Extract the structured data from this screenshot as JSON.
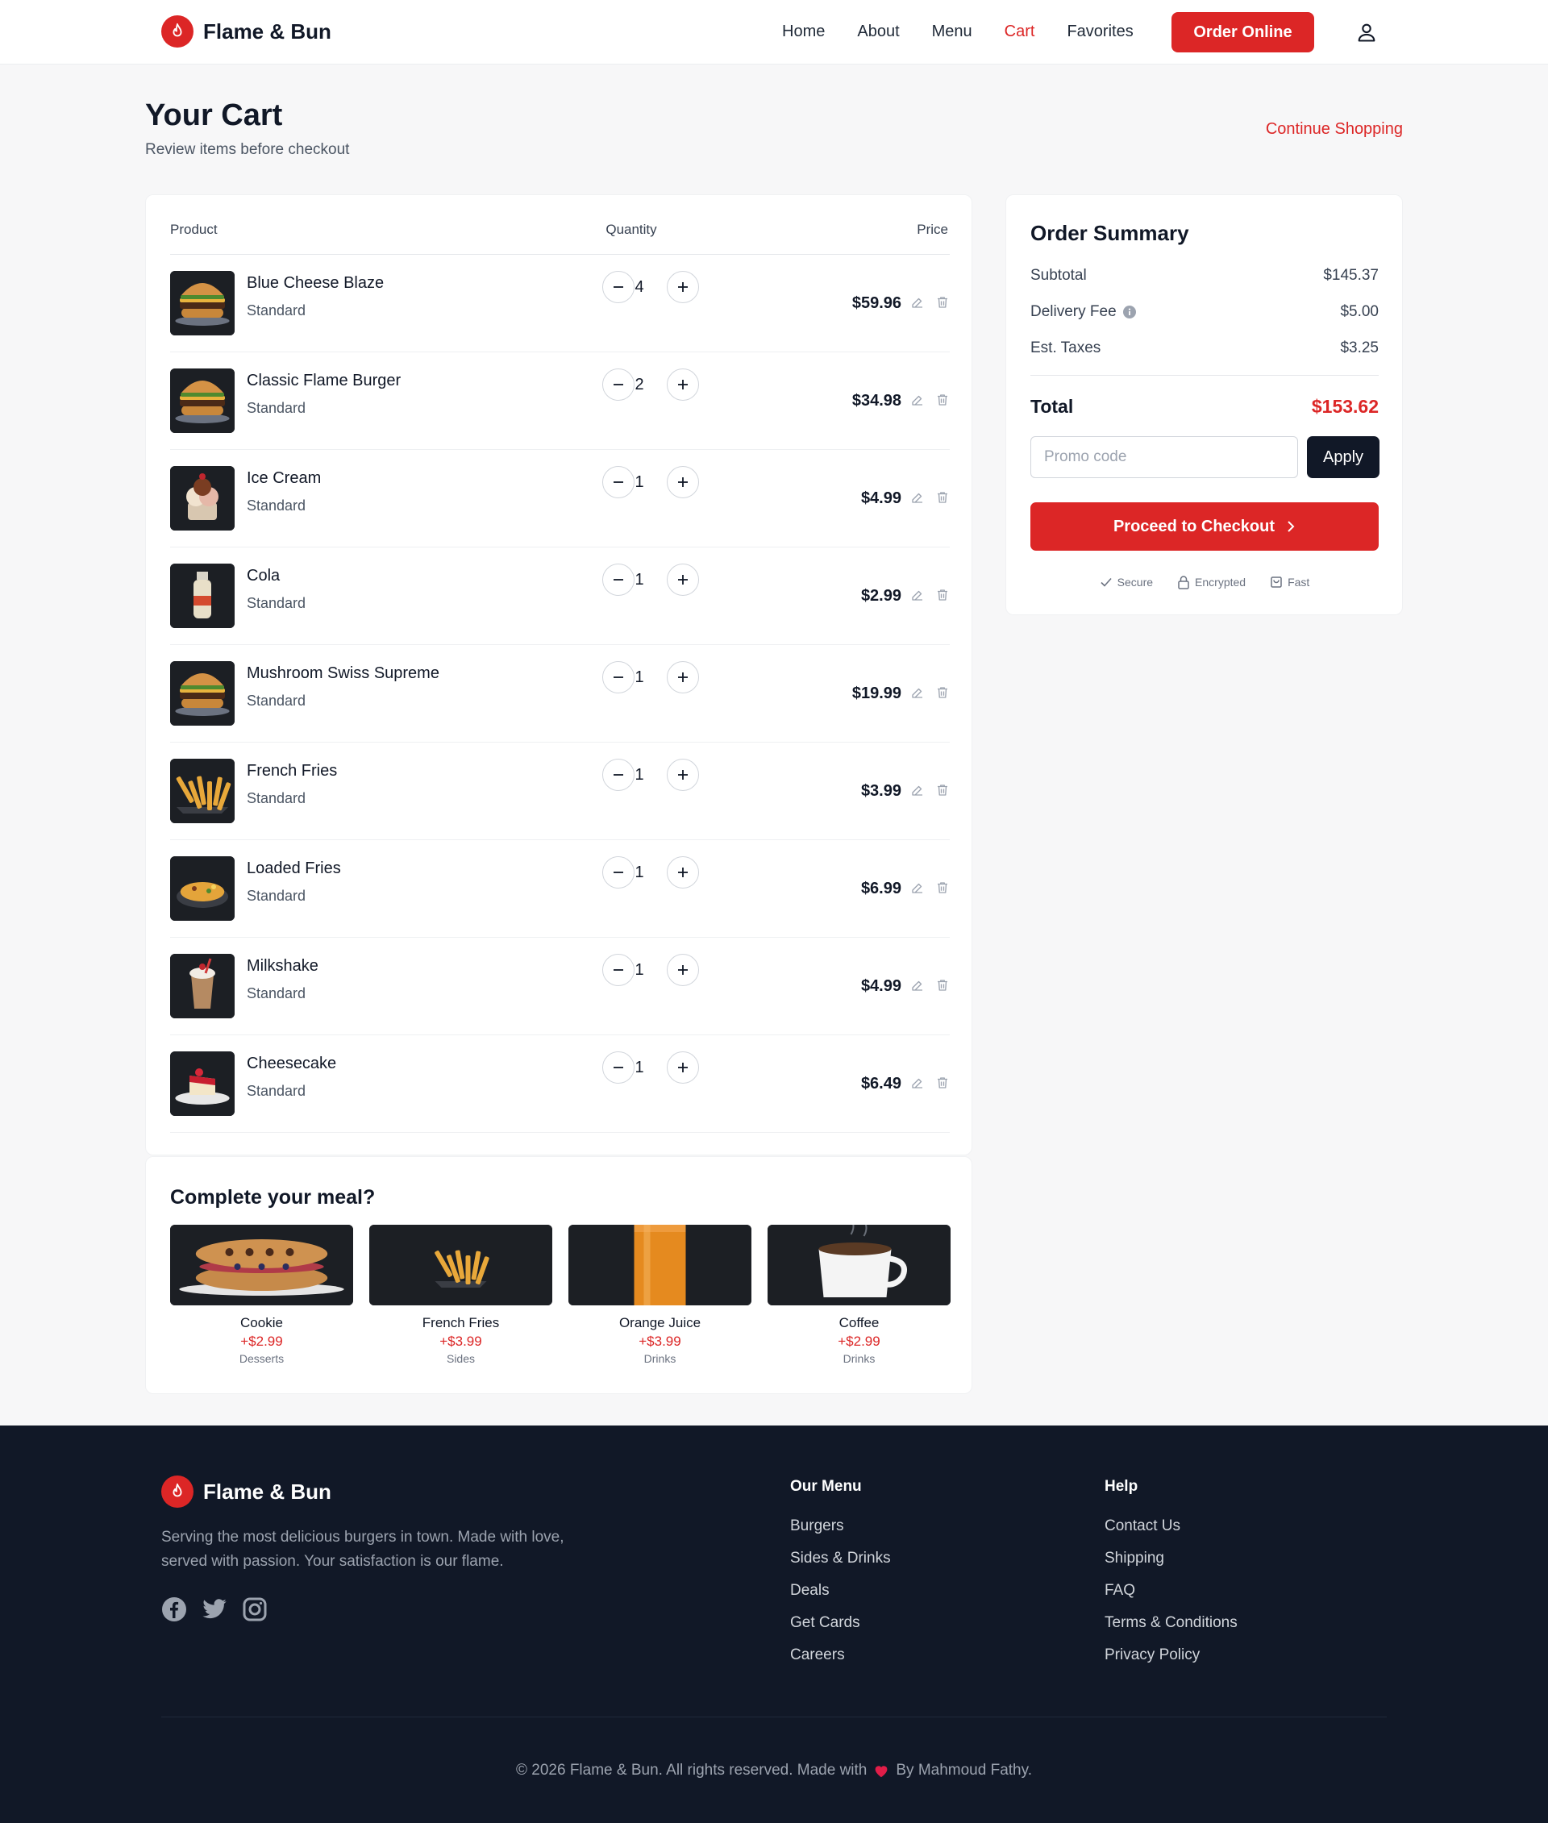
{
  "brand": {
    "name": "Flame & Bun"
  },
  "nav": {
    "items": [
      "Home",
      "About",
      "Menu",
      "Cart",
      "Favorites"
    ],
    "active": "Cart",
    "order_button": "Order Online"
  },
  "page": {
    "title": "Your Cart",
    "subtitle": "Review items before checkout",
    "continue_link": "Continue Shopping"
  },
  "cart": {
    "columns": {
      "product": "Product",
      "quantity": "Quantity",
      "price": "Price"
    },
    "items": [
      {
        "name": "Blue Cheese Blaze",
        "variant": "Standard",
        "qty": "4",
        "price": "$59.96",
        "image": "burger"
      },
      {
        "name": "Classic Flame Burger",
        "variant": "Standard",
        "qty": "2",
        "price": "$34.98",
        "image": "burger"
      },
      {
        "name": "Ice Cream",
        "variant": "Standard",
        "qty": "1",
        "price": "$4.99",
        "image": "ice-cream"
      },
      {
        "name": "Cola",
        "variant": "Standard",
        "qty": "1",
        "price": "$2.99",
        "image": "bottle"
      },
      {
        "name": "Mushroom Swiss Supreme",
        "variant": "Standard",
        "qty": "1",
        "price": "$19.99",
        "image": "burger"
      },
      {
        "name": "French Fries",
        "variant": "Standard",
        "qty": "1",
        "price": "$3.99",
        "image": "fries"
      },
      {
        "name": "Loaded Fries",
        "variant": "Standard",
        "qty": "1",
        "price": "$6.99",
        "image": "loaded-fries"
      },
      {
        "name": "Milkshake",
        "variant": "Standard",
        "qty": "1",
        "price": "$4.99",
        "image": "milkshake"
      },
      {
        "name": "Cheesecake",
        "variant": "Standard",
        "qty": "1",
        "price": "$6.49",
        "image": "cheesecake"
      }
    ]
  },
  "suggestions": {
    "title": "Complete your meal?",
    "items": [
      {
        "name": "Cookie",
        "price": "+$2.99",
        "category": "Desserts",
        "image": "cookie"
      },
      {
        "name": "French Fries",
        "price": "+$3.99",
        "category": "Sides",
        "image": "fries"
      },
      {
        "name": "Orange Juice",
        "price": "+$3.99",
        "category": "Drinks",
        "image": "juice"
      },
      {
        "name": "Coffee",
        "price": "+$2.99",
        "category": "Drinks",
        "image": "coffee"
      }
    ]
  },
  "summary": {
    "title": "Order Summary",
    "subtotal_label": "Subtotal",
    "subtotal": "$145.37",
    "delivery_label": "Delivery Fee",
    "delivery": "$5.00",
    "taxes_label": "Est. Taxes",
    "taxes": "$3.25",
    "total_label": "Total",
    "total": "$153.62",
    "promo_placeholder": "Promo code",
    "apply": "Apply",
    "checkout": "Proceed to Checkout",
    "badges": [
      "Secure",
      "Encrypted",
      "Fast"
    ]
  },
  "footer": {
    "description": "Serving the most delicious burgers in town. Made with love, served with passion. Your satisfaction is our flame.",
    "menu_title": "Our Menu",
    "menu_links": [
      "Burgers",
      "Sides & Drinks",
      "Deals",
      "Get Cards",
      "Careers"
    ],
    "help_title": "Help",
    "help_links": [
      "Contact Us",
      "Shipping",
      "FAQ",
      "Terms & Conditions",
      "Privacy Policy"
    ],
    "copyright_before": "© 2026 Flame & Bun. All rights reserved. Made with",
    "copyright_after": "By Mahmoud Fathy.",
    "social": [
      "facebook-icon",
      "twitter-icon",
      "instagram-icon"
    ]
  },
  "colors": {
    "accent": "#dc2626",
    "dark": "#111827",
    "footer_bg": "#111827"
  }
}
